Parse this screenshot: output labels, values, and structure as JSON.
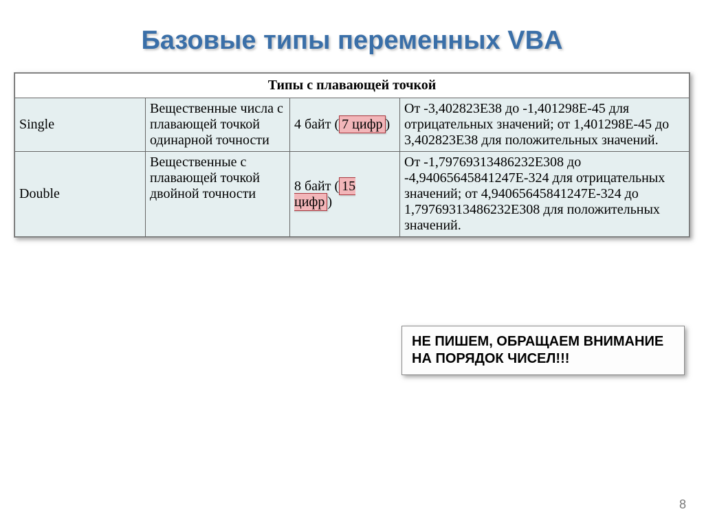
{
  "title": "Базовые типы переменных VBA",
  "table": {
    "section_header": "Типы с плавающей точкой",
    "rows": [
      {
        "name": "Single",
        "desc": "Вещественные числа с плавающей точкой одинарной точности",
        "size_pre": "4 байт (",
        "size_hl": "7 цифр",
        "size_post": ")",
        "range": "От -3,402823E38 до -1,401298E-45 для отрицательных значений; от 1,401298E-45 до 3,402823E38 для положительных значений."
      },
      {
        "name": "Double",
        "desc": "Вещественные с плавающей точкой двойной точности",
        "size_pre": "8 байт (",
        "size_hl": "15 цифр",
        "size_post": ")",
        "range": "От -1,79769313486232E308 до -4,94065645841247E-324 для отрицательных значений; от 4,94065645841247E-324 до 1,79769313486232E308 для положительных значений."
      }
    ]
  },
  "callout": "НЕ ПИШЕМ, ОБРАЩАЕМ ВНИМАНИЕ НА ПОРЯДОК ЧИСЕЛ!!!",
  "page_number": "8"
}
